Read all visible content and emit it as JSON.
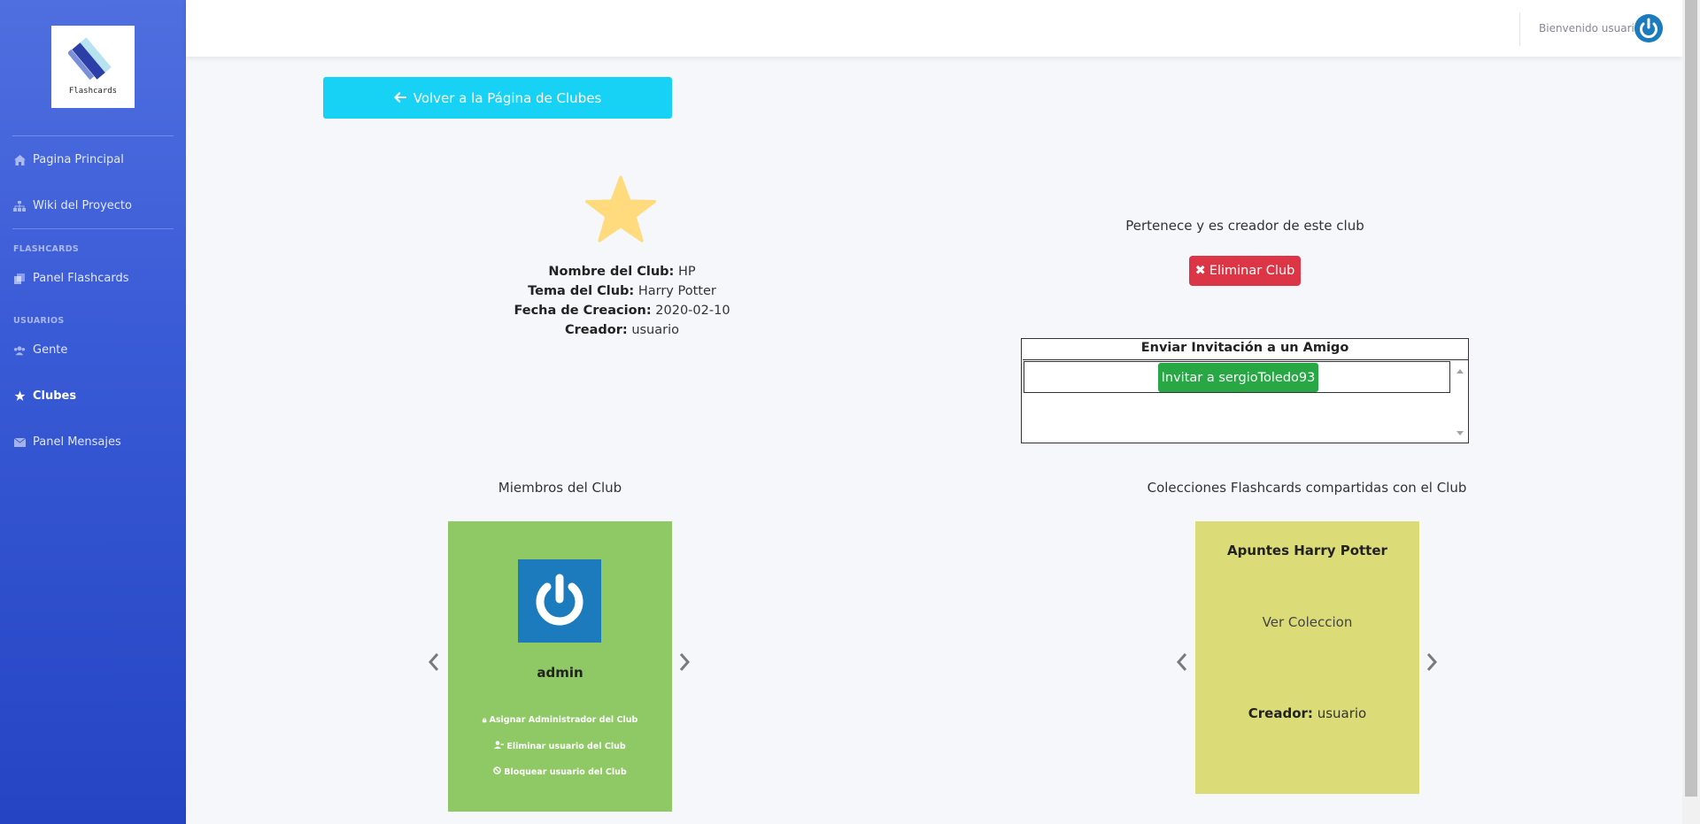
{
  "brand": {
    "text": "Flashcards"
  },
  "sidebar": {
    "items": [
      {
        "label": "Pagina Principal",
        "icon": "home-icon"
      },
      {
        "label": "Wiki del Proyecto",
        "icon": "sitemap-icon"
      },
      {
        "label": "Panel Flashcards",
        "icon": "copy-icon"
      },
      {
        "label": "Gente",
        "icon": "users-icon"
      },
      {
        "label": "Clubes",
        "icon": "star-icon",
        "active": true
      },
      {
        "label": "Panel Mensajes",
        "icon": "envelope-icon"
      }
    ],
    "headings": {
      "flashcards": "FLASHCARDS",
      "usuarios": "USUARIOS"
    }
  },
  "topbar": {
    "welcome": "Bienvenido usuario"
  },
  "back_button": {
    "label": "Volver a la Página de Clubes"
  },
  "club": {
    "name_label": "Nombre del Club:",
    "name": "HP",
    "theme_label": "Tema del Club:",
    "theme": "Harry Potter",
    "date_label": "Fecha de Creacion:",
    "date": "2020-02-10",
    "creator_label": "Creador:",
    "creator": "usuario"
  },
  "ownership": {
    "text": "Pertenece y es creador de este club",
    "delete_label": "Eliminar Club"
  },
  "invite": {
    "title": "Enviar Invitación a un Amigo",
    "button_label": "Invitar a sergioToledo93"
  },
  "members": {
    "title": "Miembros del Club",
    "card": {
      "name": "admin",
      "actions": [
        "Asignar Administrador del Club",
        "Eliminar usuario del Club",
        "Bloquear usuario del Club"
      ]
    }
  },
  "collections": {
    "title": "Colecciones Flashcards compartidas con el Club",
    "card": {
      "title": "Apuntes Harry Potter",
      "link": "Ver Coleccion",
      "creator_label": "Creador:",
      "creator": "usuario"
    }
  },
  "colors": {
    "primary": "#4e73df",
    "info": "#17d2f5",
    "danger": "#dc3545",
    "success": "#28a745",
    "member_card": "#8fc965",
    "collection_card": "#dbdb78"
  }
}
